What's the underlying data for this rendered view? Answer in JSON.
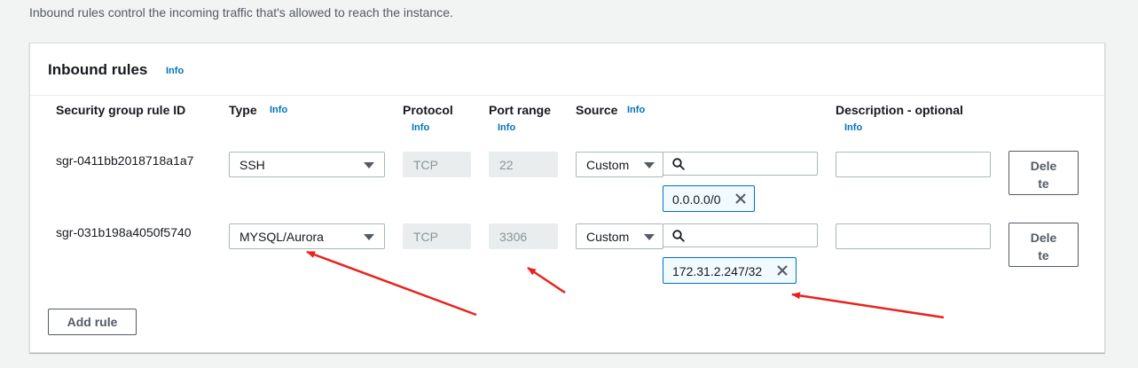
{
  "description": "Inbound rules control the incoming traffic that's allowed to reach the instance.",
  "panel": {
    "title": "Inbound rules",
    "info": "Info"
  },
  "columns": {
    "rule_id": "Security group rule ID",
    "type": "Type",
    "type_info": "Info",
    "protocol": "Protocol",
    "protocol_info": "Info",
    "port_range": "Port range",
    "port_range_info": "Info",
    "source": "Source",
    "source_info": "Info",
    "description": "Description - optional",
    "description_info": "Info"
  },
  "rules": [
    {
      "id": "sgr-0411bb2018718a1a7",
      "type": "SSH",
      "protocol": "TCP",
      "port": "22",
      "source_mode": "Custom",
      "cidr": "0.0.0.0/0",
      "description": "",
      "delete_line1": "Dele",
      "delete_line2": "te"
    },
    {
      "id": "sgr-031b198a4050f5740",
      "type": "MYSQL/Aurora",
      "protocol": "TCP",
      "port": "3306",
      "source_mode": "Custom",
      "cidr": "172.31.2.247/32",
      "description": "",
      "delete_line1": "Dele",
      "delete_line2": "te"
    }
  ],
  "add_rule": "Add rule",
  "colors": {
    "info_link": "#0073bb",
    "annotation_arrow": "#e8231f",
    "token_border": "#0073bb",
    "token_bg": "#f1faff"
  },
  "icons": {
    "type_dropdown": "caret-down-icon",
    "search": "search-icon",
    "remove_token": "close-icon"
  }
}
